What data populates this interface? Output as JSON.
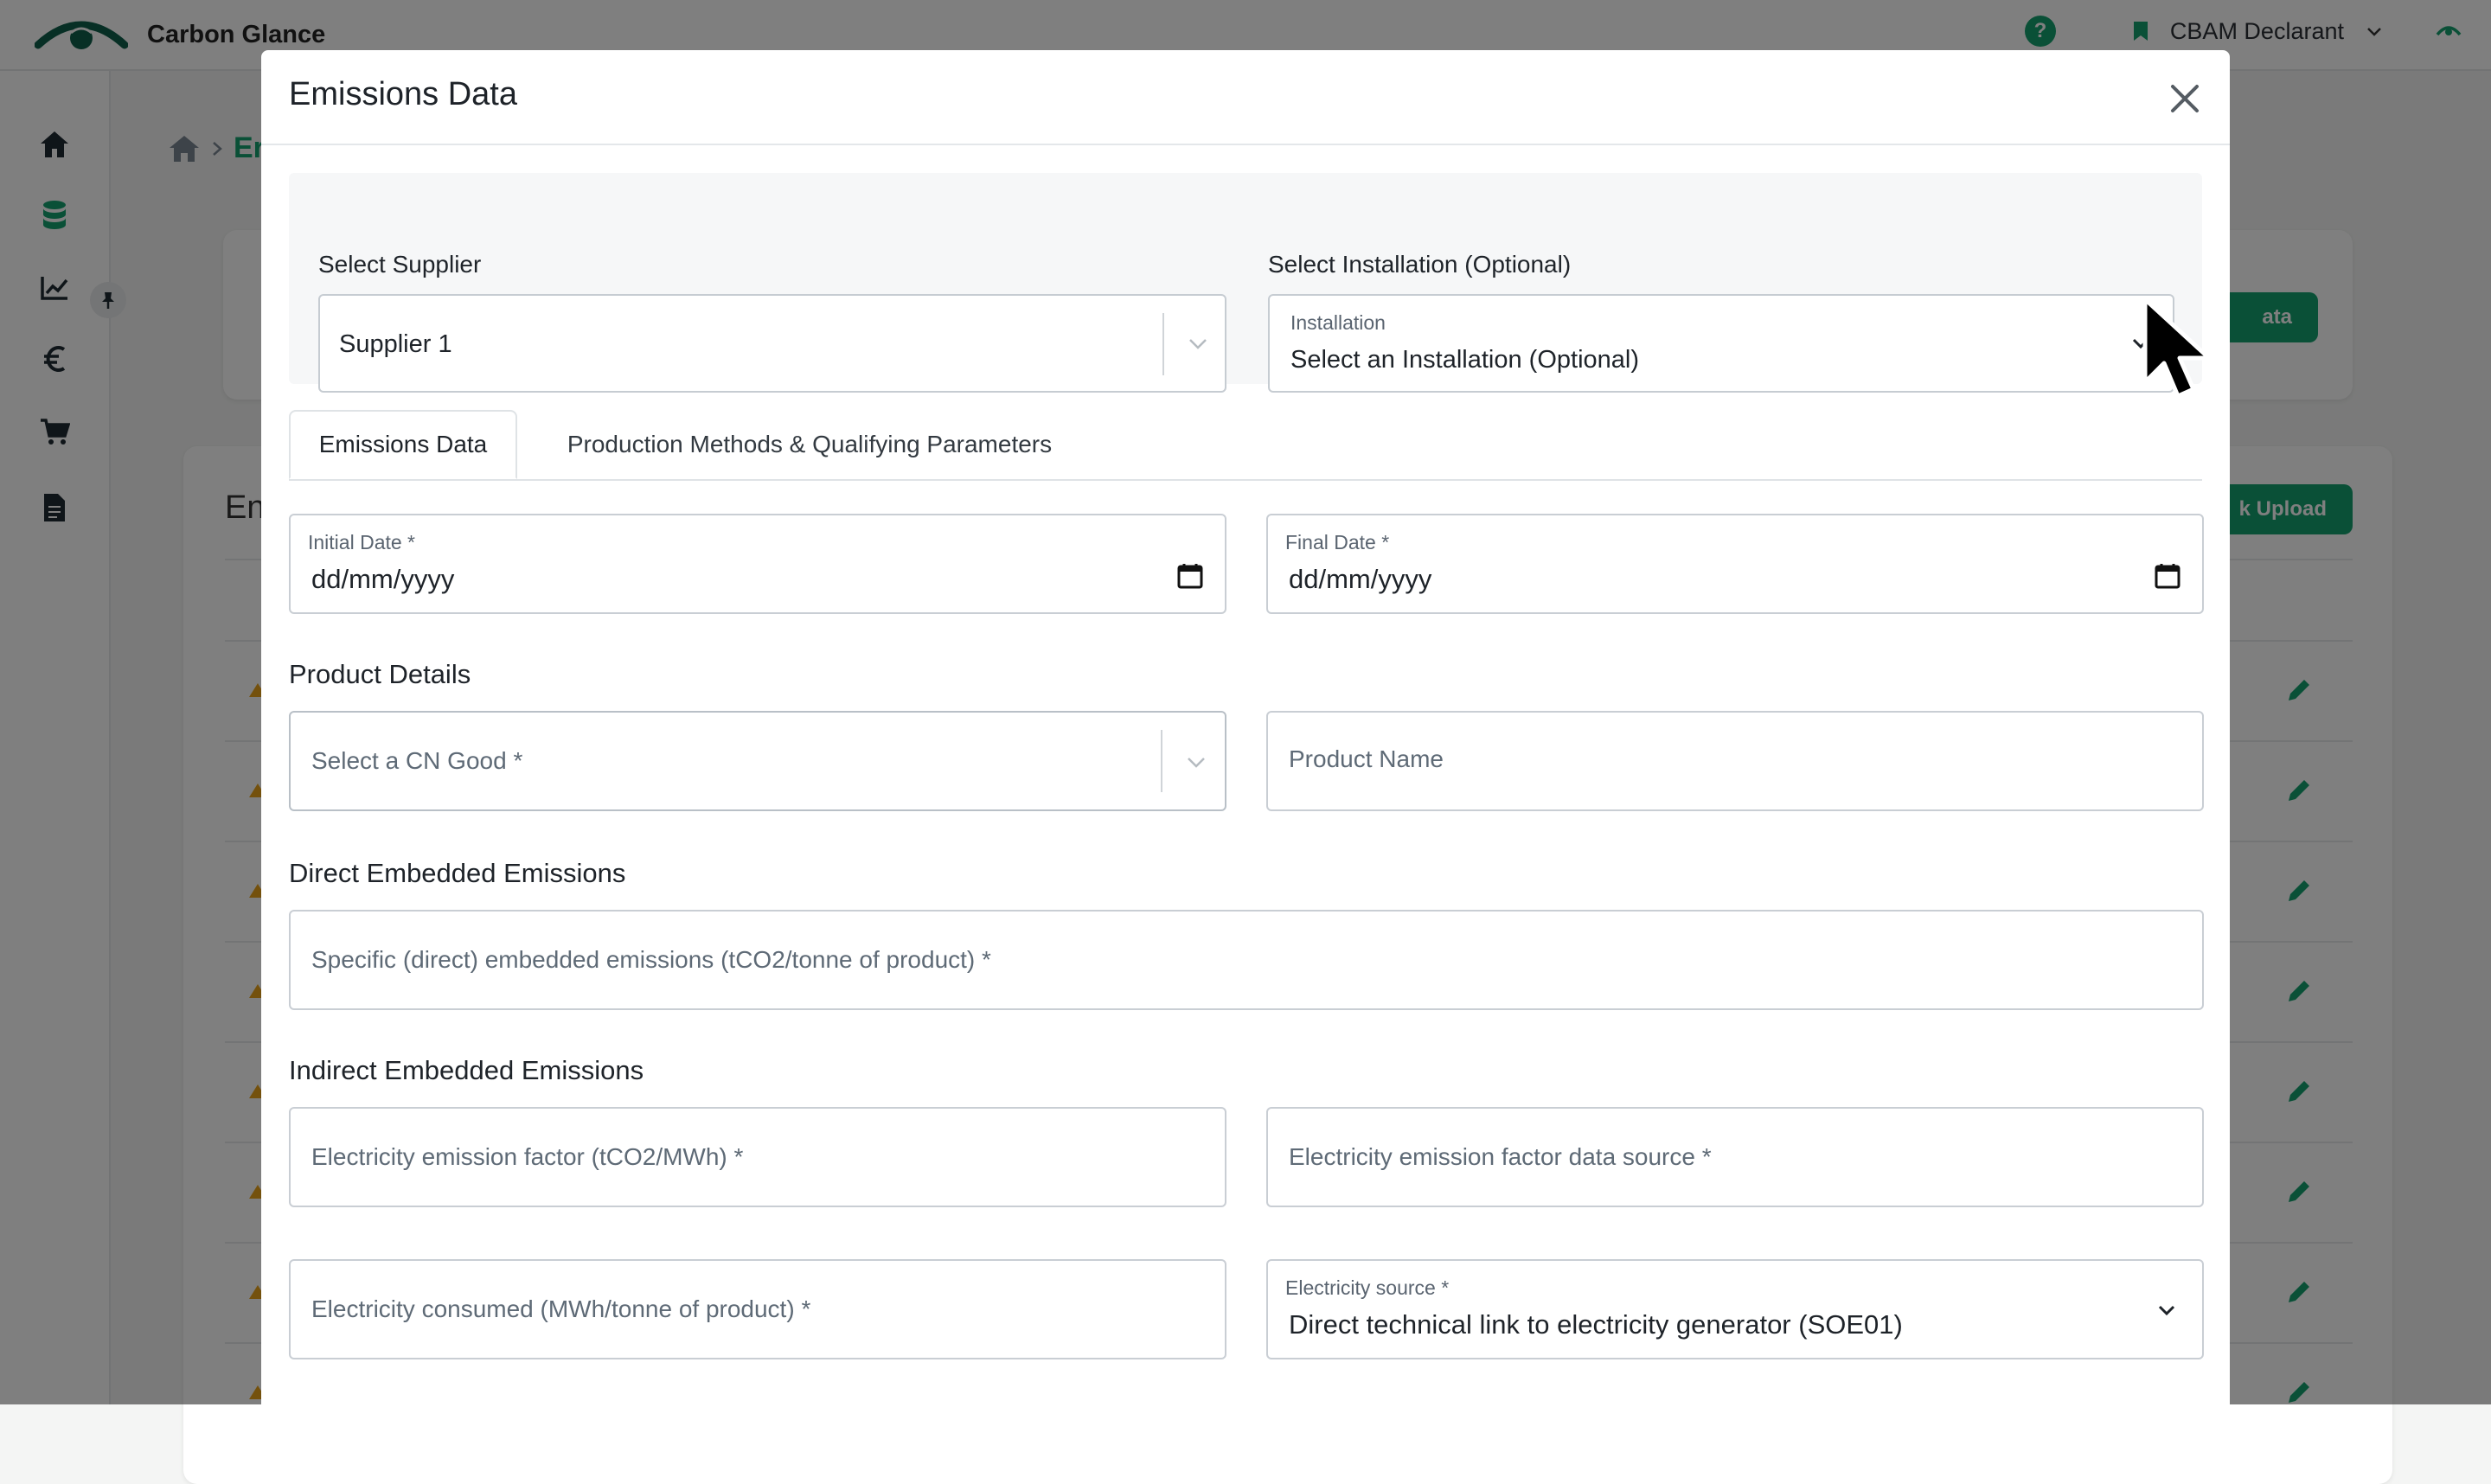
{
  "app": {
    "name": "Carbon Glance",
    "role_selector": "CBAM Declarant",
    "help_label": "?",
    "breadcrumb_partial": "Er",
    "card_title_partial": "En",
    "bg_button_1": "ata",
    "bg_button_2": "k Upload"
  },
  "colors": {
    "brand_green": "#14a06e",
    "brand_dark_green": "#0f5e4a"
  },
  "modal": {
    "title": "Emissions Data",
    "close_icon": "close-icon",
    "supplier": {
      "label": "Select Supplier",
      "value": "Supplier 1"
    },
    "installation": {
      "label": "Select Installation (Optional)",
      "floating_label": "Installation",
      "value": "Select an Installation (Optional)"
    },
    "tabs": [
      {
        "label": "Emissions Data",
        "active": true
      },
      {
        "label": "Production Methods & Qualifying Parameters",
        "active": false
      }
    ],
    "initial_date": {
      "label": "Initial Date *",
      "value": "dd/mm/yyyy"
    },
    "final_date": {
      "label": "Final Date *",
      "value": "dd/mm/yyyy"
    },
    "product_details": {
      "title": "Product Details",
      "cn_good_placeholder": "Select a CN Good *",
      "product_name_placeholder": "Product Name"
    },
    "direct": {
      "title": "Direct Embedded Emissions",
      "specific_placeholder": "Specific (direct) embedded emissions (tCO2/tonne of product) *"
    },
    "indirect": {
      "title": "Indirect Embedded Emissions",
      "ef_placeholder": "Electricity emission factor (tCO2/MWh) *",
      "ef_source_placeholder": "Electricity emission factor data source *",
      "consumed_placeholder": "Electricity consumed (MWh/tonne of product) *",
      "source_label": "Electricity source *",
      "source_value": "Direct technical link to electricity generator (SOE01)"
    }
  }
}
